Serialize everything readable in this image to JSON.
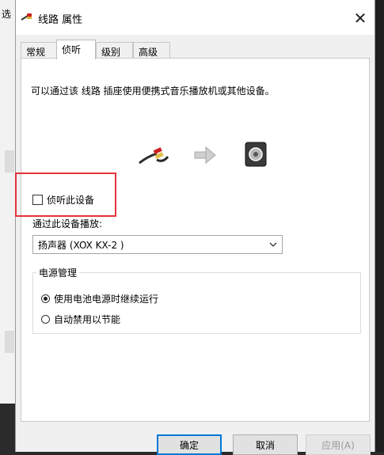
{
  "background": {
    "left_window_char": "选"
  },
  "window": {
    "title": "线路 属性",
    "close_glyph": "✕"
  },
  "tabs": [
    {
      "label": "常规",
      "active": false
    },
    {
      "label": "侦听",
      "active": true
    },
    {
      "label": "级别",
      "active": false
    },
    {
      "label": "高级",
      "active": false
    }
  ],
  "listen": {
    "description": "可以通过该 线路 插座使用便携式音乐播放机或其他设备。",
    "checkbox_label": "侦听此设备",
    "checkbox_checked": false,
    "playback_label": "通过此设备播放:",
    "playback_device": "扬声器 (XOX KX-2 )"
  },
  "power": {
    "group_title": "电源管理",
    "options": [
      {
        "label": "使用电池电源时继续运行",
        "checked": true
      },
      {
        "label": "自动禁用以节能",
        "checked": false
      }
    ]
  },
  "buttons": {
    "ok": "确定",
    "cancel": "取消",
    "apply": "应用(A)"
  },
  "colors": {
    "highlight": "#e6323c",
    "default_button_border": "#0078d7"
  },
  "icons": {
    "title": "audio-cable-icon",
    "source": "rca-cable-icon",
    "arrow": "arrow-right-icon",
    "target": "speaker-icon",
    "dropdown": "chevron-down-icon"
  }
}
